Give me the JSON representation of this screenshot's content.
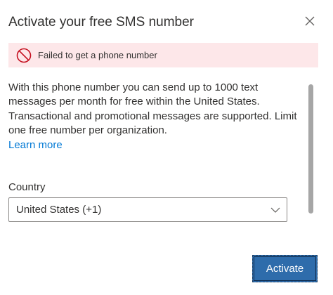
{
  "dialog": {
    "title": "Activate your free SMS number",
    "close_icon": "close-icon"
  },
  "error": {
    "icon": "blocked-icon",
    "message": "Failed to get a phone number",
    "color": "#c50f1f",
    "background": "#fde7e9"
  },
  "description": {
    "text": "With this phone number you can send up to 1000 text messages per month for free within the United States. Transactional and promotional messages are supported. Limit one free number per organization.",
    "learn_more": "Learn more"
  },
  "country": {
    "label": "Country",
    "selected": "United States (+1)",
    "icon": "chevron-down-icon"
  },
  "actions": {
    "activate_label": "Activate",
    "accent": "#2e6cab"
  }
}
